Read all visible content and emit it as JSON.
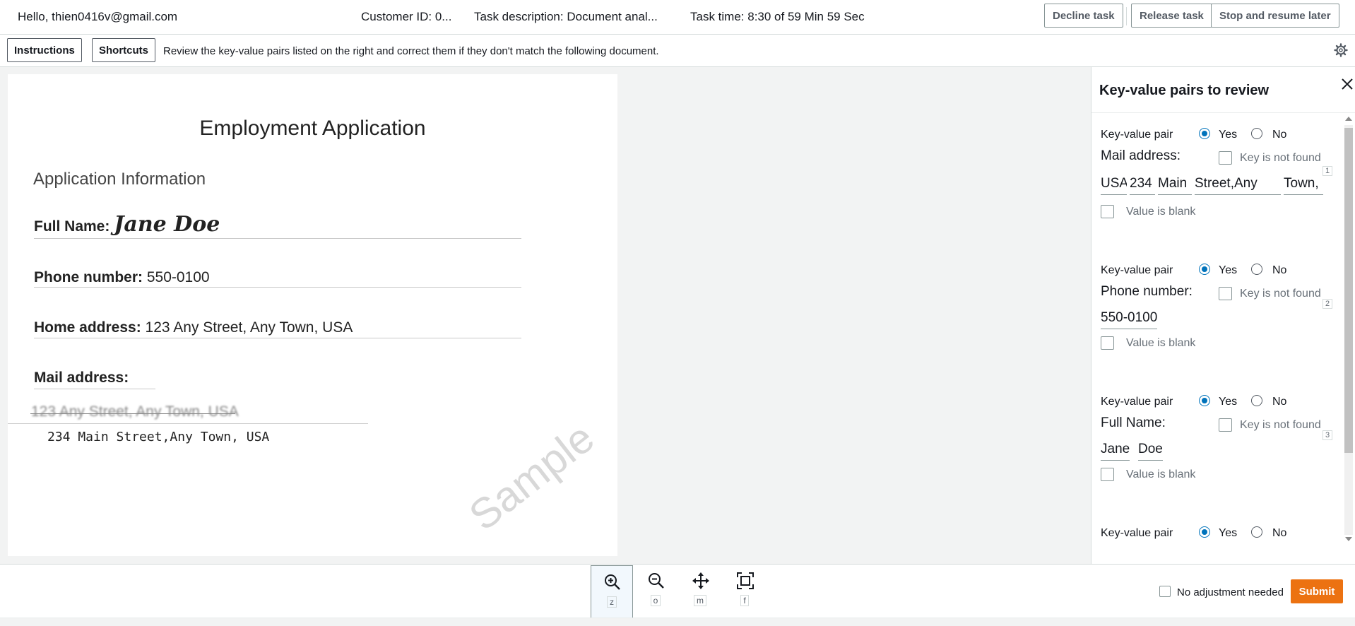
{
  "header": {
    "greeting": "Hello, thien0416v@gmail.com",
    "customer_id": "Customer ID: 0...",
    "task_description": "Task description: Document anal...",
    "task_time": "Task time: 8:30 of 59 Min 59 Sec",
    "decline_label": "Decline task",
    "release_label": "Release task",
    "stop_label": "Stop and resume later"
  },
  "toolbar": {
    "instructions_label": "Instructions",
    "shortcuts_label": "Shortcuts",
    "instruction_text": "Review the key-value pairs listed on the right and correct them if they don't match the following document.",
    "settings_icon": "gear-icon"
  },
  "document": {
    "title": "Employment Application",
    "section": "Application Information",
    "full_name_label": "Full Name:",
    "full_name_value": "Jane Doe",
    "phone_label": "Phone number:",
    "phone_value": " 550-0100",
    "home_label": "Home address:",
    "home_value": " 123 Any Street, Any Town, USA",
    "mail_label": "Mail address:",
    "mail_struck": "123 Any Street, Any Town, USA",
    "mail_handwritten": "234 Main Street,Any Town, USA",
    "watermark": "Sample"
  },
  "panel": {
    "title": "Key-value pairs to review",
    "pairs": [
      {
        "pair_label": "Key-value pair",
        "yes": "Yes",
        "no": "No",
        "selected": "Yes",
        "key": "Mail address:",
        "key_not_found": "Key is not found",
        "values": [
          "USA",
          "234",
          "Main",
          "Street,Any",
          "Town,"
        ],
        "value_blank": "Value is blank",
        "index": "1"
      },
      {
        "pair_label": "Key-value pair",
        "yes": "Yes",
        "no": "No",
        "selected": "Yes",
        "key": "Phone number:",
        "key_not_found": "Key is not found",
        "values": [
          "550-0100"
        ],
        "value_blank": "Value is blank",
        "index": "2"
      },
      {
        "pair_label": "Key-value pair",
        "yes": "Yes",
        "no": "No",
        "selected": "Yes",
        "key": "Full Name:",
        "key_not_found": "Key is not found",
        "values": [
          "Jane",
          "Doe"
        ],
        "value_blank": "Value is blank",
        "index": "3"
      },
      {
        "pair_label": "Key-value pair",
        "yes": "Yes",
        "no": "No",
        "selected": "Yes"
      }
    ]
  },
  "bottom": {
    "tools": [
      {
        "icon": "zoom-in-icon",
        "key": "z"
      },
      {
        "icon": "zoom-out-icon",
        "key": "o"
      },
      {
        "icon": "move-icon",
        "key": "m"
      },
      {
        "icon": "fit-screen-icon",
        "key": "f"
      }
    ],
    "no_adjust_label": "No adjustment needed",
    "submit_label": "Submit"
  }
}
